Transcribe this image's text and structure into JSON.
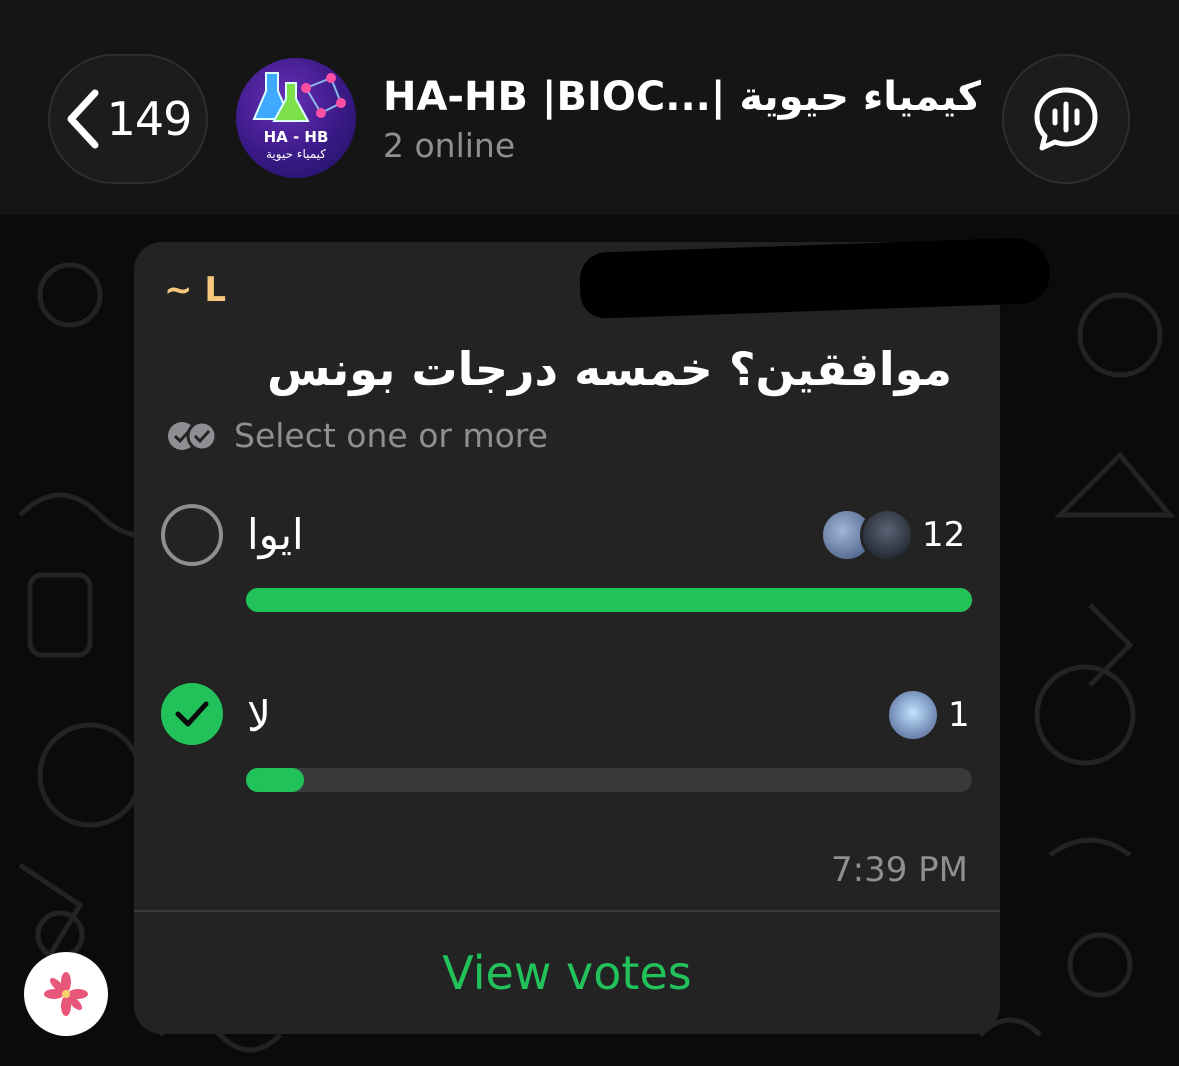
{
  "header": {
    "back_count": "149",
    "avatar_text_line1": "HA - HB",
    "avatar_text_line2": "كيمياء حيوية",
    "title": "HA-HB |BIOC...| كيمياء حيوية",
    "subtitle": "2 online"
  },
  "message": {
    "sender": "~ L",
    "poll": {
      "question": "موافقين؟ خمسه درجات بونس",
      "hint": "Select one or more",
      "options": [
        {
          "label": "ايوا",
          "votes": "12",
          "fraction": 1.0,
          "selected": false
        },
        {
          "label": "لا",
          "votes": "1",
          "fraction": 0.08,
          "selected": true
        }
      ],
      "view_votes": "View votes"
    },
    "time": "7:39 PM"
  },
  "colors": {
    "accent_green": "#22c25a",
    "sender_color": "#f6c77d",
    "bubble": "#232323",
    "muted": "#8e8e93"
  },
  "icons": [
    "chevron-left-icon",
    "group-avatar",
    "voice-chat-icon",
    "double-check-icon",
    "checkmark-icon",
    "flower-icon"
  ]
}
